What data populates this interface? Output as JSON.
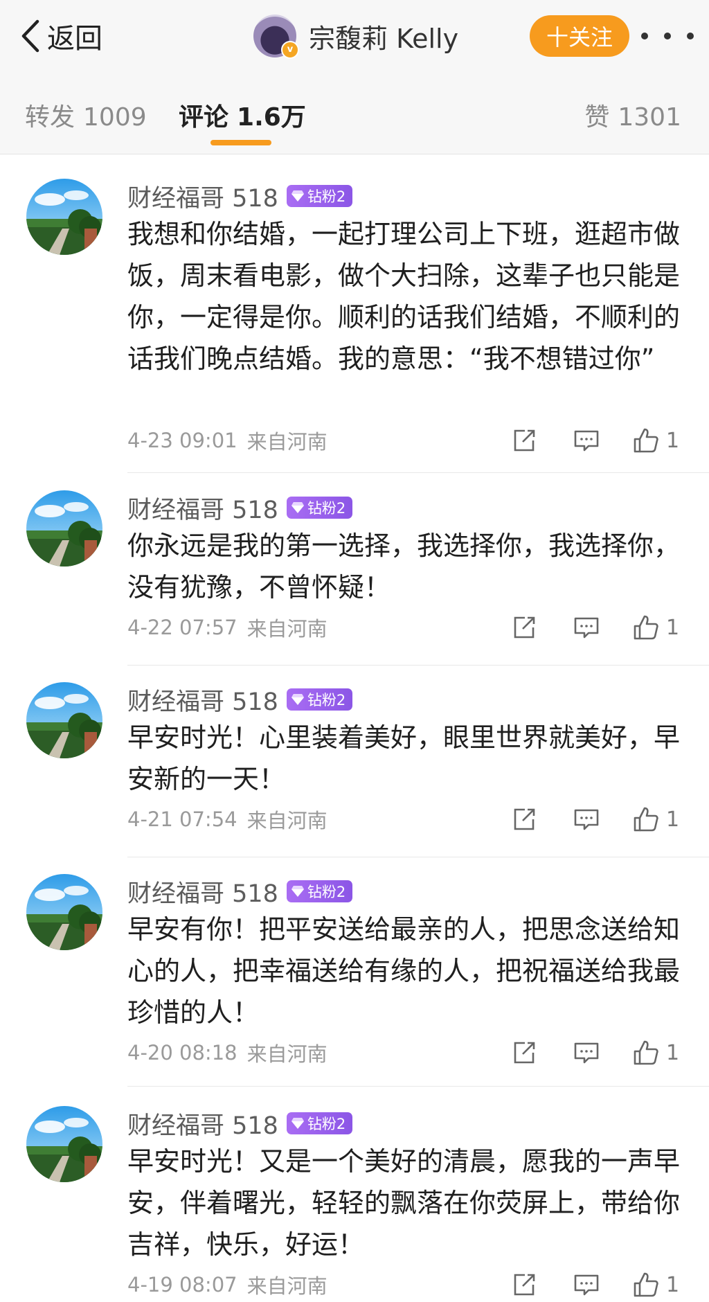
{
  "header": {
    "back_label": "返回",
    "profile_name": "宗馥莉 Kelly",
    "follow_label": "十关注"
  },
  "tabs": [
    {
      "label": "转发",
      "count": "1009"
    },
    {
      "label": "评论",
      "count": "1.6万"
    },
    {
      "label": "赞",
      "count": "1301"
    }
  ],
  "comments": [
    {
      "user": "财经福哥 518",
      "badge": "钻粉2",
      "text": "我想和你结婚，一起打理公司上下班，逛超市做饭，周末看电影，做个大扫除，这辈子也只能是你，一定得是你。顺利的话我们结婚，不顺利的话我们晚点结婚。我的意思：“我不想错过你”",
      "time": "4-23 09:01",
      "source": "来自河南",
      "likes": "1"
    },
    {
      "user": "财经福哥 518",
      "badge": "钻粉2",
      "text": "你永远是我的第一选择，我选择你，我选择你，没有犹豫，不曾怀疑！",
      "time": "4-22 07:57",
      "source": "来自河南",
      "likes": "1"
    },
    {
      "user": "财经福哥 518",
      "badge": "钻粉2",
      "text": "早安时光！心里装着美好，眼里世界就美好，早安新的一天！",
      "time": "4-21 07:54",
      "source": "来自河南",
      "likes": "1"
    },
    {
      "user": "财经福哥 518",
      "badge": "钻粉2",
      "text": "早安有你！把平安送给最亲的人，把思念送给知心的人，把幸福送给有缘的人，把祝福送给我最珍惜的人！",
      "time": "4-20 08:18",
      "source": "来自河南",
      "likes": "1"
    },
    {
      "user": "财经福哥 518",
      "badge": "钻粉2",
      "text": "早安时光！又是一个美好的清晨，愿我的一声早安，伴着曙光，轻轻的飘落在你荧屏上，带给你吉祥，快乐，好运！",
      "time": "4-19 08:07",
      "source": "来自河南",
      "likes": "1"
    }
  ],
  "icons": {
    "back": "chevron-left-icon",
    "more": "more-dots-icon",
    "share": "share-icon",
    "reply": "comment-icon",
    "like": "thumbs-up-icon",
    "badge": "diamond-icon"
  },
  "colors": {
    "accent": "#f79b1e",
    "badge": "#9a5eec",
    "meta": "#9a9a9a"
  }
}
